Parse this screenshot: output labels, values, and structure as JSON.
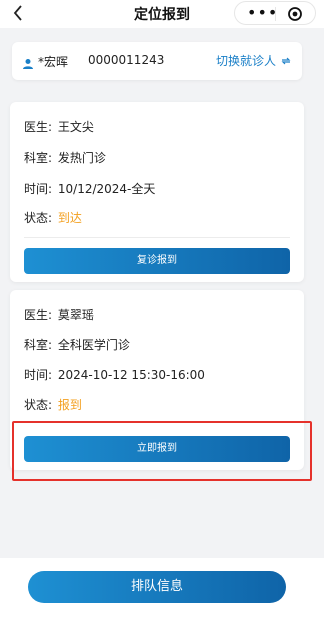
{
  "header": {
    "back_icon": "chevron-left-icon",
    "title": "定位报到",
    "more_label": "•••",
    "target_icon": "target-icon"
  },
  "patient": {
    "name": "*宏晖",
    "id": "0000011243",
    "switch_label": "切换就诊人"
  },
  "appointments": [
    {
      "doctor_label": "医生:",
      "doctor": "王文尖",
      "dept_label": "科室:",
      "dept": "发热门诊",
      "time_label": "时间:",
      "time": "10/12/2024-全天",
      "status_label": "状态:",
      "status": "到达",
      "button": "复诊报到"
    },
    {
      "doctor_label": "医生:",
      "doctor": "莫翠瑶",
      "dept_label": "科室:",
      "dept": "全科医学门诊",
      "time_label": "时间:",
      "time": "2024-10-12 15:30-16:00",
      "status_label": "状态:",
      "status": "报到",
      "button": "立即报到"
    }
  ],
  "footer": {
    "button": "排队信息"
  },
  "colors": {
    "accent": "#1a7fc7",
    "status": "#f3a01f",
    "highlight": "#e5312b"
  }
}
